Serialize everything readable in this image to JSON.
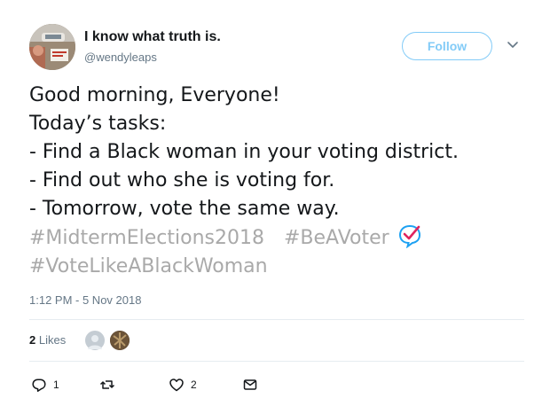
{
  "tweet": {
    "display_name": "I know what truth is.",
    "handle": "@wendyleaps",
    "follow_label": "Follow",
    "lines": [
      "Good morning, Everyone!",
      "Today’s tasks:",
      "- Find a Black woman in your voting district.",
      "- Find out who she is voting for.",
      "- Tomorrow, vote the same way."
    ],
    "hashtag_1": "#MidtermElections2018",
    "hashtag_2": "#BeAVoter",
    "hashtag_3": "#VoteLikeABlackWoman",
    "emoji_icon": "check-speech-bubble-icon",
    "timestamp": "1:12 PM - 5 Nov 2018",
    "likes_count": "2",
    "likes_label": "Likes",
    "reply_count": "1",
    "like_count": "2"
  },
  "colors": {
    "accent": "#1da1f2",
    "hashtag": "#a9a9a9",
    "muted": "#657786",
    "check_red": "#e0245e"
  },
  "icons": {
    "caret": "chevron-down-icon",
    "reply": "reply-icon",
    "retweet": "retweet-icon",
    "like": "heart-icon",
    "message": "direct-message-icon"
  }
}
